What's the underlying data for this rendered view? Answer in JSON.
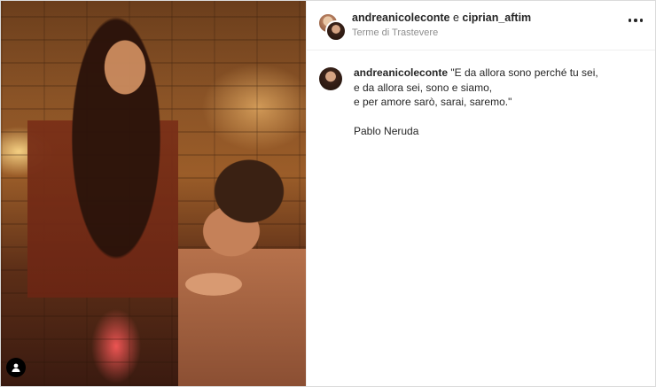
{
  "header": {
    "user1": "andreanicoleconte",
    "joiner": "e",
    "user2": "ciprian_aftim",
    "location": "Terme di Trastevere"
  },
  "caption": {
    "username": "andreanicoleconte",
    "lines": [
      "\"E da allora sono perché tu sei,",
      "e da allora sei, sono e siamo,",
      "e per amore sarò, sarai, saremo.\""
    ],
    "signature": "Pablo Neruda"
  },
  "icons": {
    "more": "more-options-icon",
    "tag": "user-tag-icon"
  }
}
